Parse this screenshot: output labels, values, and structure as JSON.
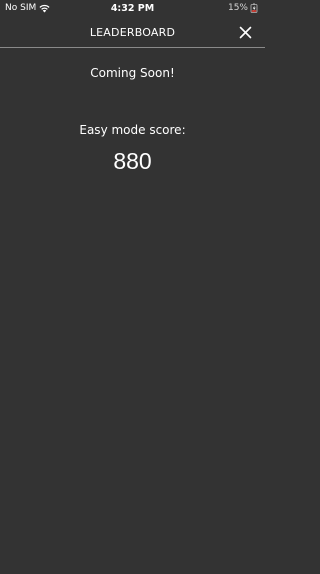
{
  "status_bar": {
    "carrier": "No SIM",
    "time": "4:32 PM",
    "battery": "15%",
    "wifi_icon": "wifi-icon",
    "battery_icon": "battery-charging-icon"
  },
  "nav": {
    "title": "LEADERBOARD",
    "close_icon": "close-icon"
  },
  "content": {
    "coming_soon": "Coming Soon!",
    "score_label": "Easy mode score:",
    "score_value": "880"
  },
  "colors": {
    "background": "#333333",
    "text": "#ffffff",
    "divider": "#8a8a8a"
  }
}
